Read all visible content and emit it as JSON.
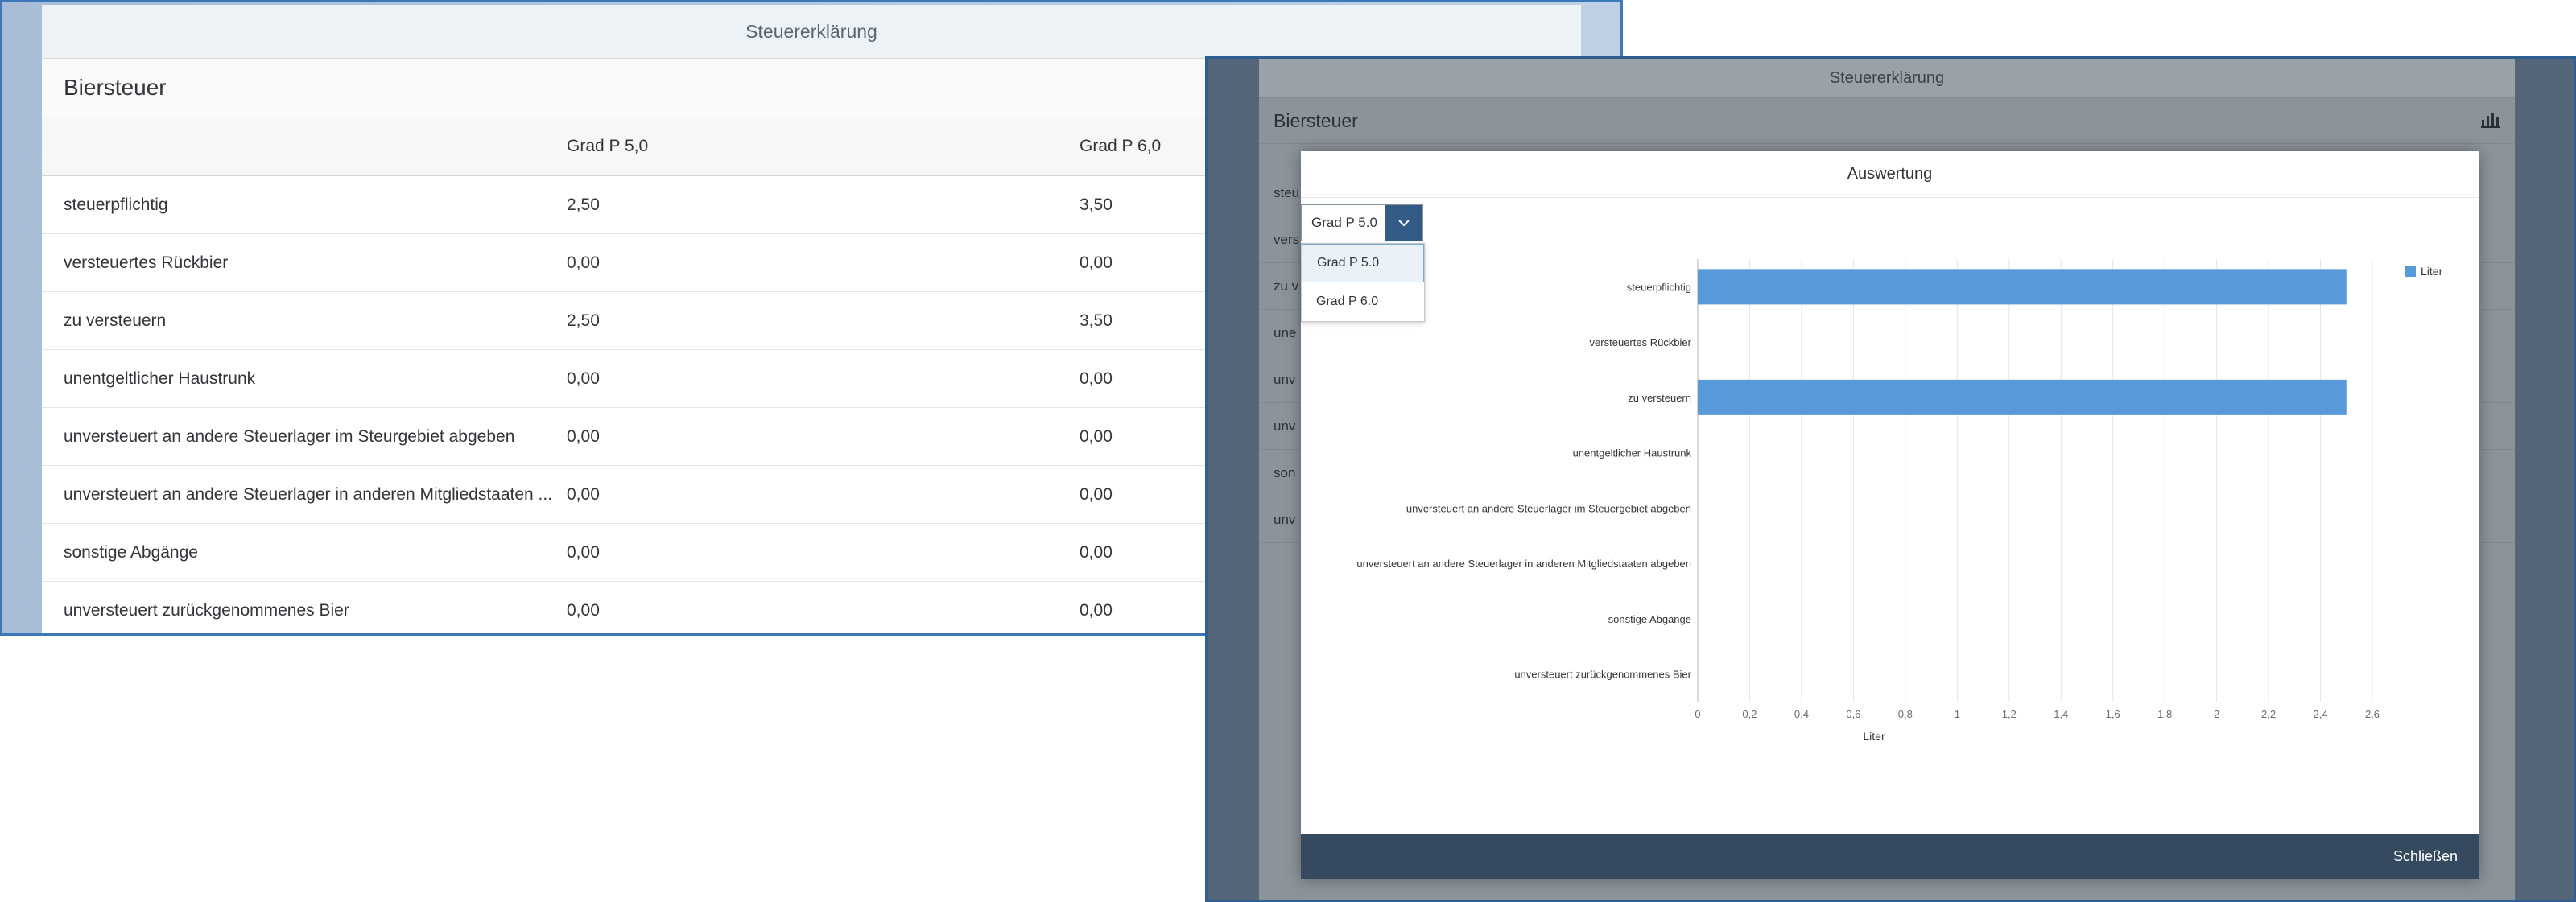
{
  "left_window": {
    "app_title": "Steuererklärung",
    "section_title": "Biersteuer",
    "columns": [
      "",
      "Grad P 5,0",
      "Grad P 6,0"
    ],
    "rows": [
      {
        "label": "steuerpflichtig",
        "p50": "2,50",
        "p60": "3,50"
      },
      {
        "label": "versteuertes Rückbier",
        "p50": "0,00",
        "p60": "0,00"
      },
      {
        "label": "zu versteuern",
        "p50": "2,50",
        "p60": "3,50"
      },
      {
        "label": "unentgeltlicher Haustrunk",
        "p50": "0,00",
        "p60": "0,00"
      },
      {
        "label": "unversteuert an andere Steuerlager im Steurgebiet abgeben",
        "p50": "0,00",
        "p60": "0,00"
      },
      {
        "label": "unversteuert an andere Steuerlager in anderen Mitgliedstaaten ...",
        "p50": "0,00",
        "p60": "0,00"
      },
      {
        "label": "sonstige Abgänge",
        "p50": "0,00",
        "p60": "0,00"
      },
      {
        "label": "unversteuert zurückgenommenes Bier",
        "p50": "0,00",
        "p60": "0,00"
      }
    ]
  },
  "right_window": {
    "app_title": "Steuererklärung",
    "section_title": "Biersteuer",
    "chart_icon": "bar-chart-icon",
    "bg_row_fragments": [
      "steu",
      "vers",
      "zu v",
      "une",
      "unv",
      "unv",
      "son",
      "unv"
    ],
    "dialog": {
      "title": "Auswertung",
      "select": {
        "value": "Grad P 5.0",
        "options": [
          "Grad P 5.0",
          "Grad P 6.0"
        ],
        "selected_index": 0
      },
      "close_label": "Schließen"
    }
  },
  "colors": {
    "bar": "#5899da",
    "accent": "#345b86",
    "footer": "#354a5f",
    "window_border": "#3a78b8"
  },
  "chart_data": {
    "type": "bar",
    "orientation": "horizontal",
    "categories": [
      "steuerpflichtig",
      "versteuertes Rückbier",
      "zu versteuern",
      "unentgeltlicher Haustrunk",
      "unversteuert an andere Steuerlager im Steuergebiet abgeben",
      "unversteuert an andere Steuerlager in anderen Mitgliedstaaten abgeben",
      "sonstige Abgänge",
      "unversteuert zurückgenommenes Bier"
    ],
    "series": [
      {
        "name": "Liter",
        "values": [
          2.5,
          0,
          2.5,
          0,
          0,
          0,
          0,
          0
        ]
      }
    ],
    "xlabel": "Liter",
    "ylabel": "",
    "xlim": [
      0,
      2.6
    ],
    "ticks": [
      "0",
      "0,2",
      "0,4",
      "0,6",
      "0,8",
      "1",
      "1,2",
      "1,4",
      "1,6",
      "1,8",
      "2",
      "2,2",
      "2,4",
      "2,6"
    ],
    "grid": true,
    "legend": "top-right"
  }
}
